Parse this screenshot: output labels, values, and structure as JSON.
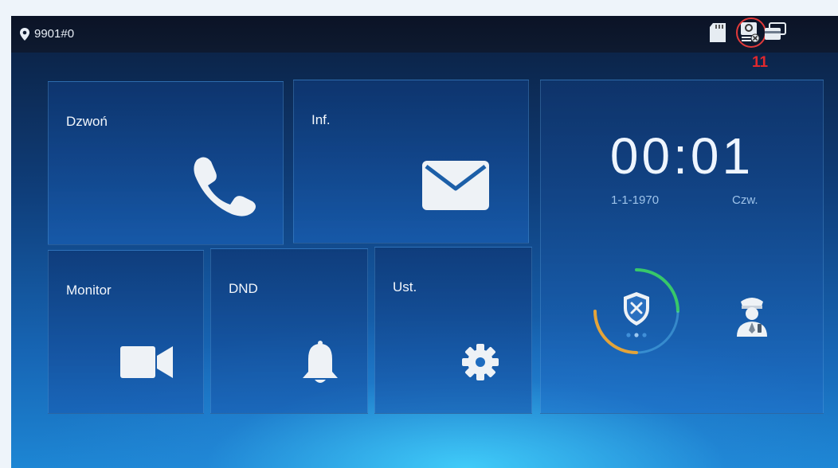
{
  "status_bar": {
    "location_text": "9901#0",
    "icons": [
      "sd-card-icon",
      "network-offline-icon",
      "cards-icon"
    ]
  },
  "annotation": {
    "number": "11",
    "color": "#e0282d"
  },
  "tiles": [
    {
      "label": "Dzwoń",
      "icon": "phone-icon"
    },
    {
      "label": "Inf.",
      "icon": "envelope-icon"
    },
    {
      "label": "Monitor",
      "icon": "video-camera-icon"
    },
    {
      "label": "DND",
      "icon": "bell-icon"
    },
    {
      "label": "Ust.",
      "icon": "gear-icon"
    }
  ],
  "clock": {
    "time": "00:01",
    "date": "1-1-1970",
    "day": "Czw."
  },
  "arming": {
    "icon": "shield-disarmed-icon",
    "page_dots": 3
  },
  "guard": {
    "icon": "security-guard-icon"
  },
  "colors": {
    "background_top": "#0b1e3d",
    "background_bottom": "#1d86d4",
    "dial_green": "#37c86a",
    "dial_orange": "#e3a43a"
  }
}
